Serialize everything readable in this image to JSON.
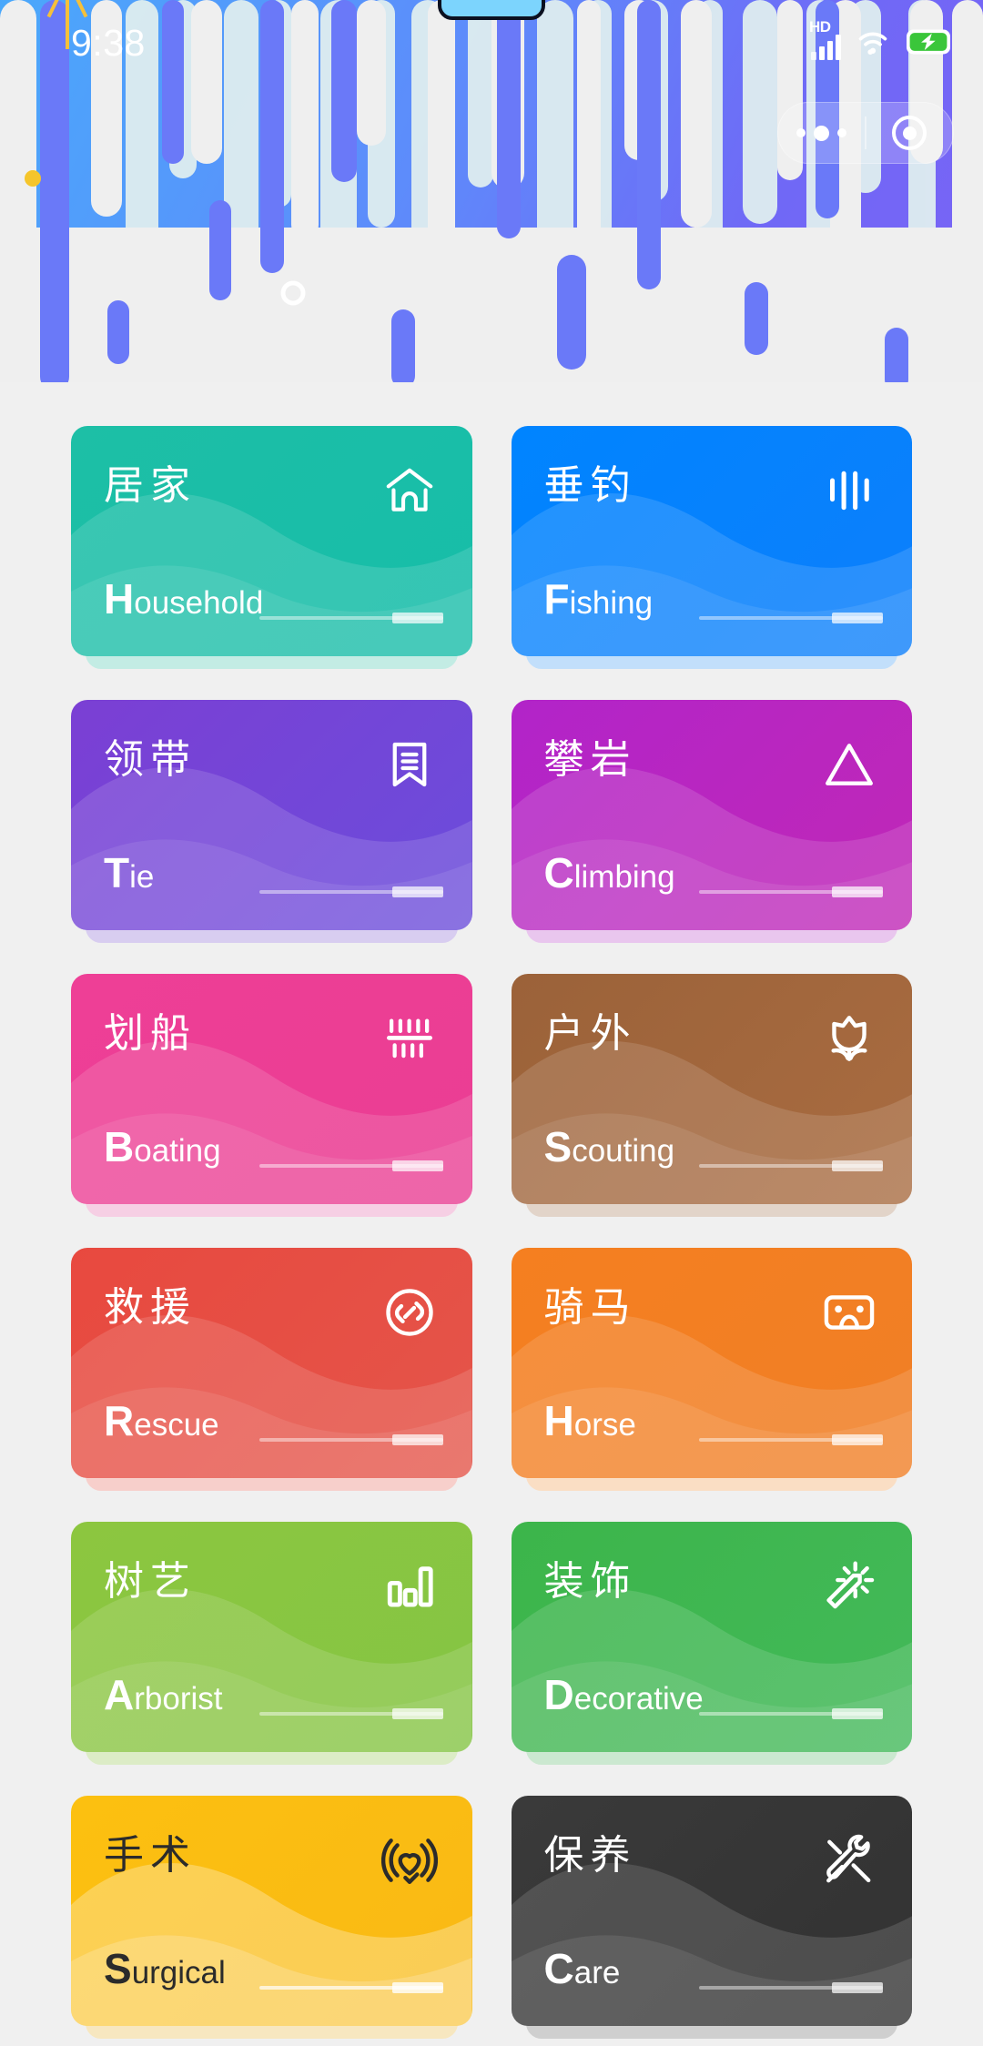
{
  "status_bar": {
    "time": "9:38",
    "network_label": "HD",
    "icons": [
      "signal-icon",
      "wifi-icon",
      "battery-charging-icon"
    ]
  },
  "capsule": {
    "more_label": "more-options",
    "close_label": "close-mini-program"
  },
  "header": {
    "decoration": "dripping-bars-pattern"
  },
  "cards": [
    {
      "cn": "居家",
      "en_initial": "H",
      "en_rest": "ousehold",
      "icon": "home-icon",
      "color_from": "#1dbfa6",
      "color_to": "#17bda9",
      "shadow": "#c3ece4",
      "text_theme": "light"
    },
    {
      "cn": "垂钓",
      "en_initial": "F",
      "en_rest": "ishing",
      "icon": "sound-bars-icon",
      "color_from": "#0084ff",
      "color_to": "#0d7ffb",
      "shadow": "#c2dffb",
      "text_theme": "light"
    },
    {
      "cn": "领带",
      "en_initial": "T",
      "en_rest": "ie",
      "icon": "bookmark-lines-icon",
      "color_from": "#7b3fd4",
      "color_to": "#6b4ddb",
      "shadow": "#d8cdf0",
      "text_theme": "light"
    },
    {
      "cn": "攀岩",
      "en_initial": "C",
      "en_rest": "limbing",
      "icon": "triangle-mountain-icon",
      "color_from": "#b224c9",
      "color_to": "#c028b6",
      "shadow": "#e9c6ee",
      "text_theme": "light"
    },
    {
      "cn": "划船",
      "en_initial": "B",
      "en_rest": "oating",
      "icon": "barcode-comb-icon",
      "color_from": "#ee3f96",
      "color_to": "#ea3d93",
      "shadow": "#f6cfe4",
      "text_theme": "light"
    },
    {
      "cn": "户外",
      "en_initial": "S",
      "en_rest": "couting",
      "icon": "tulip-flower-icon",
      "color_from": "#9b6239",
      "color_to": "#a96c41",
      "shadow": "#e2d4c9",
      "text_theme": "light"
    },
    {
      "cn": "救援",
      "en_initial": "R",
      "en_rest": "escue",
      "icon": "link-circle-icon",
      "color_from": "#e8493f",
      "color_to": "#e4554a",
      "shadow": "#f7cfcb",
      "text_theme": "light"
    },
    {
      "cn": "骑马",
      "en_initial": "H",
      "en_rest": "orse",
      "icon": "vr-cardboard-icon",
      "color_from": "#f57f20",
      "color_to": "#f07f26",
      "shadow": "#fadec4",
      "text_theme": "light"
    },
    {
      "cn": "树艺",
      "en_initial": "A",
      "en_rest": "rborist",
      "icon": "bar-chart-icon",
      "color_from": "#8cc63f",
      "color_to": "#85c544",
      "shadow": "#dcecc6",
      "text_theme": "light"
    },
    {
      "cn": "装饰",
      "en_initial": "D",
      "en_rest": "ecorative",
      "icon": "magic-wand-icon",
      "color_from": "#3cb54a",
      "color_to": "#43b95a",
      "shadow": "#cbe8d0",
      "text_theme": "light"
    },
    {
      "cn": "手术",
      "en_initial": "S",
      "en_rest": "urgical",
      "icon": "heart-pulse-check-icon",
      "color_from": "#fcc010",
      "color_to": "#f9b915",
      "shadow": "#f7e7c0",
      "text_theme": "dark"
    },
    {
      "cn": "保养",
      "en_initial": "C",
      "en_rest": "are",
      "icon": "tools-wrench-icon",
      "color_from": "#3a3a3a",
      "color_to": "#323232",
      "shadow": "#cfcfcf",
      "text_theme": "light"
    }
  ]
}
